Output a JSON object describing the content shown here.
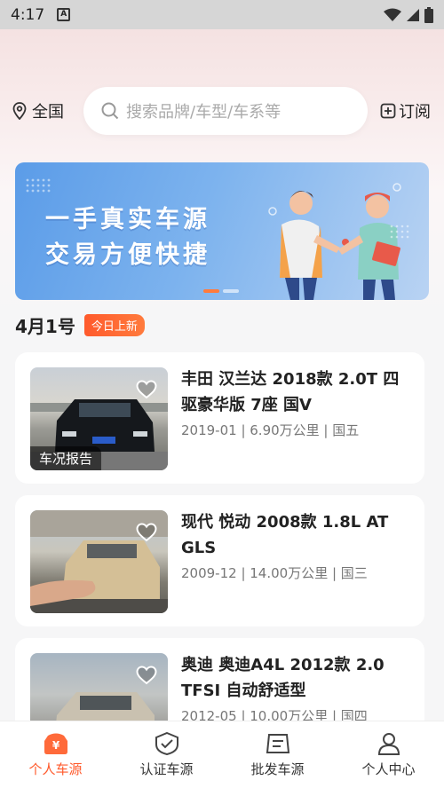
{
  "status_bar": {
    "time": "4:17"
  },
  "header": {
    "location_label": "全国",
    "search_placeholder": "搜索品牌/车型/车系等",
    "subscribe_label": "订阅"
  },
  "banner": {
    "line1": "一手真实车源",
    "line2": "交易方便快捷",
    "slides_total": 2,
    "active_slide": 1
  },
  "section": {
    "date_label": "4月1号",
    "badge": "今日上新"
  },
  "listings": [
    {
      "title": "丰田 汉兰达 2018款 2.0T 四驱豪华版 7座 国V",
      "meta": "2019-01 | 6.90万公里 | 国五",
      "report_tag": "车况报告"
    },
    {
      "title": "现代 悦动 2008款 1.8L AT GLS",
      "meta": "2009-12 | 14.00万公里 | 国三",
      "report_tag": ""
    },
    {
      "title": "奥迪 奥迪A4L 2012款 2.0 TFSI 自动舒适型",
      "meta": "2012-05 | 10.00万公里 | 国四",
      "report_tag": ""
    }
  ],
  "bottom_nav": [
    {
      "label": "个人车源",
      "icon": "car-source-icon",
      "active": true
    },
    {
      "label": "认证车源",
      "icon": "certified-icon",
      "active": false
    },
    {
      "label": "批发车源",
      "icon": "wholesale-icon",
      "active": false
    },
    {
      "label": "个人中心",
      "icon": "user-icon",
      "active": false
    }
  ],
  "colors": {
    "accent": "#ff5a2c",
    "banner_blue": "#5b9ce8"
  }
}
